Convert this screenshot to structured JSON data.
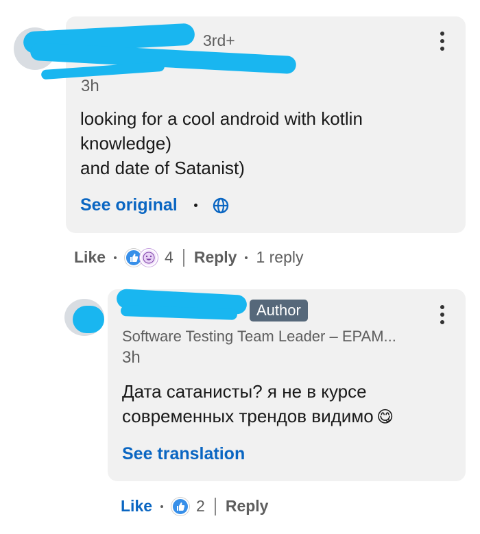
{
  "comment": {
    "degree": "3rd+",
    "time": "3h",
    "text": "looking for a cool android with kotlin\nknowledge)\nand date of Satanist)",
    "see_original": "See original",
    "actions": {
      "like": "Like",
      "reaction_count": "4",
      "reply": "Reply",
      "reply_count": "1 reply"
    }
  },
  "reply": {
    "badge": "Author",
    "headline": "Software Testing Team Leader – EPAM...",
    "time": "3h",
    "text": "Дата сатанисты? я не в курсе\nсовременных трендов видимо",
    "emoji": "😋",
    "see_translation": "See translation",
    "actions": {
      "like": "Like",
      "reaction_count": "2",
      "reply": "Reply"
    }
  },
  "icons": {
    "menu": "kebab-menu-icon",
    "globe": "globe-icon",
    "like_reaction": "thumbs-up-icon",
    "funny_reaction": "laughing-face-icon"
  },
  "colors": {
    "accent": "#0a66c2",
    "bubble": "#f1f1f1",
    "redaction": "#19b6f0",
    "author_badge": "#56687a"
  }
}
